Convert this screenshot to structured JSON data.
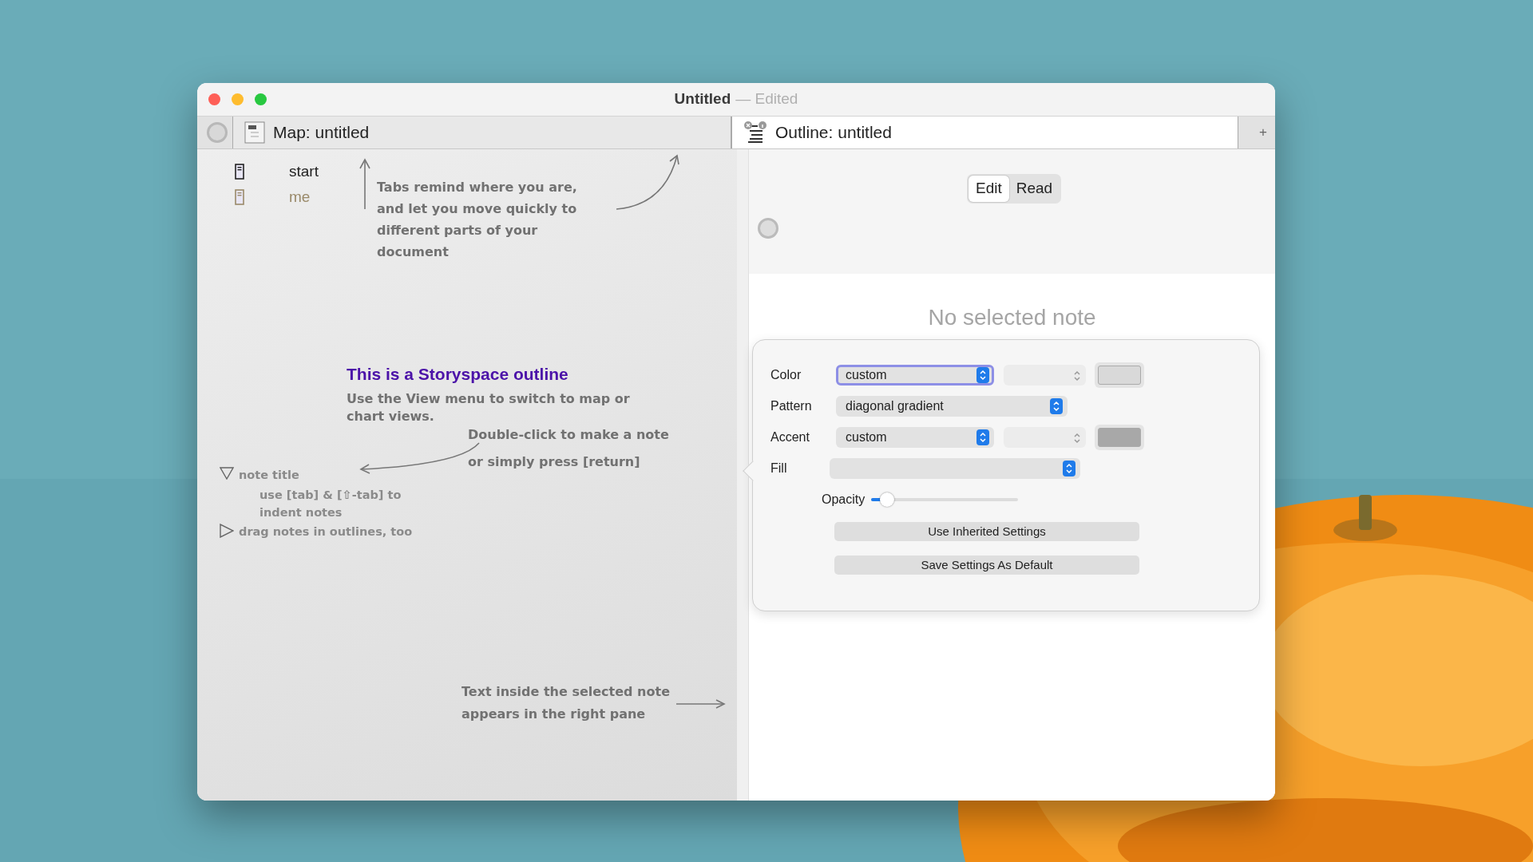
{
  "window": {
    "title": "Untitled",
    "status": "— Edited"
  },
  "tabs": [
    {
      "label": "Map: untitled",
      "kind": "map",
      "selected": false
    },
    {
      "label": "Outline: untitled",
      "kind": "outline",
      "selected": true
    }
  ],
  "add_tab": "+",
  "outline_pane": {
    "items": [
      {
        "title": "start",
        "color": "#222222"
      },
      {
        "title": "me",
        "color": "#9a8a6a"
      }
    ],
    "tabs_hint": [
      "Tabs remind where you are,",
      "and let you move quickly to",
      "different parts of your",
      "document"
    ],
    "heading": "This is a Storyspace outline",
    "view_hint": [
      "Use the View menu to switch to map or",
      "chart views."
    ],
    "click_hint": [
      "Double-click to make a note",
      "or simply press [return]"
    ],
    "sample_outline": [
      {
        "title": "note title",
        "expanded": true,
        "children": [
          {
            "title": "use [tab] & [⇧-tab] to indent notes"
          }
        ]
      },
      {
        "title": "drag notes in outlines, too",
        "expanded": false
      }
    ],
    "pane_hint": [
      "Text inside the selected note",
      "appears in the right pane"
    ]
  },
  "text_pane": {
    "modes": [
      {
        "label": "Edit",
        "selected": true
      },
      {
        "label": "Read",
        "selected": false
      }
    ],
    "empty_message": "No selected note",
    "popover": {
      "rows": [
        {
          "kind": "popup-swatch",
          "label": "Color",
          "value": "custom",
          "focused": true,
          "color": "#d9d9d9"
        },
        {
          "kind": "popup",
          "label": "Pattern",
          "value": "diagonal gradient",
          "focused": false
        },
        {
          "kind": "popup-swatch",
          "label": "Accent",
          "value": "custom",
          "focused": false,
          "color": "#a8a8a8"
        },
        {
          "kind": "popup-wide",
          "label": "Fill",
          "focused": false
        },
        {
          "kind": "slider",
          "label": "Opacity",
          "level": 0.11
        }
      ],
      "buttons": [
        "Use Inherited Settings",
        "Save Settings As Default"
      ]
    }
  }
}
